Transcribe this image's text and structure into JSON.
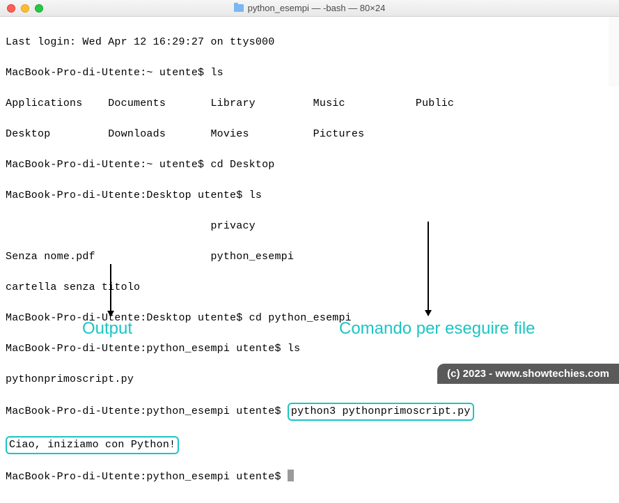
{
  "window": {
    "title": "python_esempi — -bash — 80×24"
  },
  "terminal": {
    "last_login": "Last login: Wed Apr 12 16:29:27 on ttys000",
    "prompt_home": "MacBook-Pro-di-Utente:~ utente$ ",
    "prompt_desktop": "MacBook-Pro-di-Utente:Desktop utente$ ",
    "prompt_python": "MacBook-Pro-di-Utente:python_esempi utente$ ",
    "cmd_ls": "ls",
    "cmd_cd_desktop": "cd Desktop",
    "cmd_cd_python": "cd python_esempi",
    "cmd_run_python": "python3 pythonprimoscript.py",
    "home_row1": "Applications    Documents       Library         Music           Public",
    "home_row2": "Desktop         Downloads       Movies          Pictures",
    "desktop_row1": "                                privacy",
    "desktop_row2": "Senza nome.pdf                  python_esempi",
    "desktop_row3": "cartella senza titolo",
    "python_ls_out": "pythonprimoscript.py",
    "python_output": "Ciao, iniziamo con Python!"
  },
  "captions": {
    "output": "Output",
    "command": "Comando per eseguire file"
  },
  "watermark": "(c) 2023 - www.showtechies.com"
}
